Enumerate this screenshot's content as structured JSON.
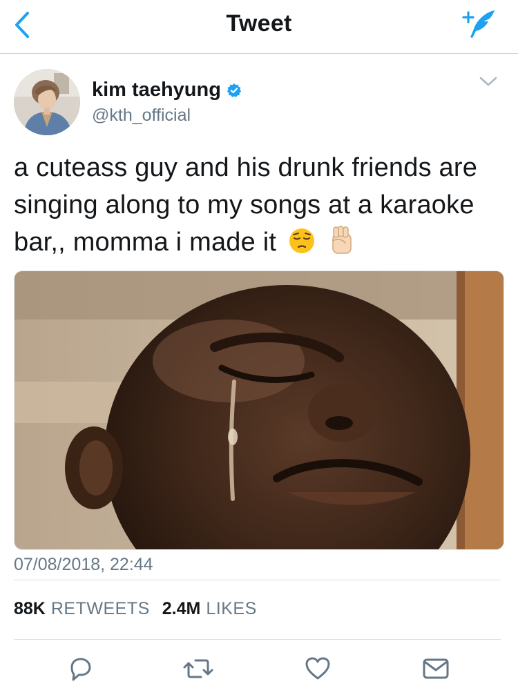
{
  "nav": {
    "title": "Tweet",
    "back_icon": "chevron-left-icon",
    "compose_icon": "compose-tweet-icon",
    "accent_color": "#1da1f2"
  },
  "author": {
    "name": "kim taehyung",
    "handle": "@kth_official",
    "verified": true
  },
  "tweet": {
    "text": "a cuteass guy and his drunk friends are singing along to my songs at a karaoke bar,, momma i made it",
    "emojis": [
      "pensive-face-icon",
      "raised-fist-icon"
    ],
    "media": "photo of a crying man (meme image)",
    "timestamp": "07/08/2018, 22:44"
  },
  "stats": {
    "retweets_count": "88K",
    "retweets_label": "RETWEETS",
    "likes_count": "2.4M",
    "likes_label": "LIKES"
  },
  "actions": [
    "reply-icon",
    "retweet-icon",
    "like-icon",
    "direct-message-icon"
  ],
  "colors": {
    "text": "#14171a",
    "secondary": "#657786",
    "divider": "#d8dde1"
  }
}
